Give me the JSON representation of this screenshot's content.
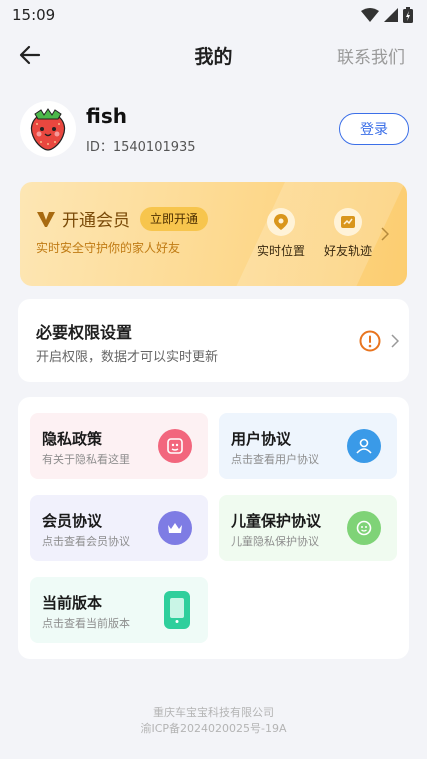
{
  "status_bar": {
    "time": "15:09"
  },
  "header": {
    "title": "我的",
    "contact": "联系我们"
  },
  "profile": {
    "name": "fish",
    "id": "ID：1540101935",
    "login": "登录"
  },
  "vip": {
    "title": "开通会员",
    "open": "立即开通",
    "subtitle": "实时安全守护你的家人好友",
    "features": [
      {
        "label": "实时位置",
        "icon": "location-pin-icon"
      },
      {
        "label": "好友轨迹",
        "icon": "track-icon"
      }
    ]
  },
  "permission": {
    "title": "必要权限设置",
    "subtitle": "开启权限，数据才可以实时更新"
  },
  "menu": [
    {
      "title": "隐私政策",
      "subtitle": "有关于隐私看这里",
      "icon": "privacy-icon"
    },
    {
      "title": "用户协议",
      "subtitle": "点击查看用户协议",
      "icon": "user-agreement-icon"
    },
    {
      "title": "会员协议",
      "subtitle": "点击查看会员协议",
      "icon": "member-agreement-icon"
    },
    {
      "title": "儿童保护协议",
      "subtitle": "儿童隐私保护协议",
      "icon": "child-protection-icon"
    },
    {
      "title": "当前版本",
      "subtitle": "点击查看当前版本",
      "icon": "phone-version-icon"
    }
  ],
  "footer": {
    "company": "重庆车宝宝科技有限公司",
    "icp": "渝ICP备2024020025号-19A"
  },
  "colors": {
    "accent": "#3b6fe8",
    "vip_gold": "#f7c54d",
    "warning": "#e8741e"
  }
}
